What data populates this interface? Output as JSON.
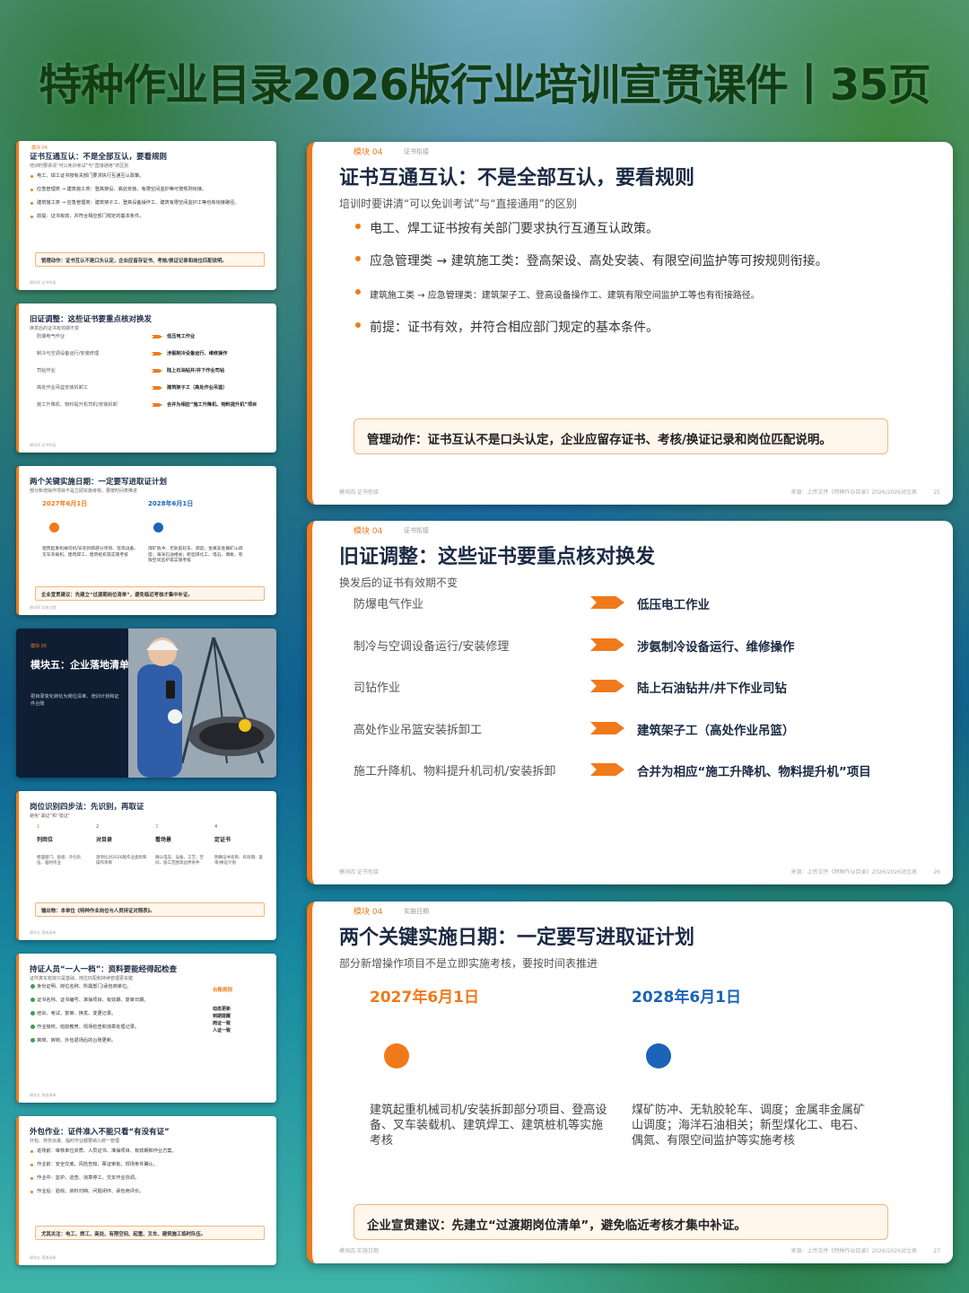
{
  "main_title": "特种作业目录2026版行业培训宣贯课件丨35页",
  "thumbs": {
    "t1": {
      "tag": "模块 04",
      "title": "证书互通互认：不是全部互认，要看规则",
      "sub": "培训时要讲清“可以免训考试”与“直接通用”的区别",
      "lines": [
        "电工、焊工证书按有关部门要求执行互通互认政策。",
        "应急管理类 → 建筑施工类：登高架设、高处安装、有限空间监护等可按规则衔接。",
        "建筑施工类 → 应急管理类：建筑架子工、登高设备操作工、建筑有限空间监护工等也有衔接路径。",
        "前提：证书有效，并符合相应部门规定的基本条件。"
      ],
      "box": "管理动作：证书互认不是口头认定，企业应留存证书、考核/换证记录和岗位匹配说明。",
      "foot": "模块四 证书衔接"
    },
    "t2": {
      "title": "旧证调整：这些证书要重点核对换发",
      "sub": "换发后的证书有效期不变",
      "left": [
        "防爆电气作业",
        "制冷与空调设备运行/安装修理",
        "司钻作业",
        "高处作业吊篮安装拆卸工",
        "施工升降机、物料提升机司机/安装拆卸"
      ],
      "right": [
        "低压电工作业",
        "涉氨制冷设备运行、维修操作",
        "陆上石油钻井/井下作业司钻",
        "建筑架子工（高处作业吊篮）",
        "合并为相应“施工升降机、物料提升机”项目"
      ],
      "foot": "模块四 证书衔接"
    },
    "t3": {
      "title": "两个关键实施日期：一定要写进取证计划",
      "sub": "部分新增操作项目不是立即实施考核，要按时间表推进",
      "d1": "2027年6月1日",
      "d2": "2028年6月1日",
      "desc1": "建筑起重机械司机/安装拆卸部分项目、登高设备、叉车装载机、建筑焊工、建筑桩机等实施考核",
      "desc2": "煤矿防冲、无轨胶轮车、调度；金属非金属矿山调度；海洋石油相关；新型煤化工、电石、偶氮、有限空间监护等实施考核",
      "box": "企业宣贯建议：先建立“过渡期岗位清单”，避免临近考核才集中补证。",
      "foot": "模块四 实施日期"
    },
    "t4": {
      "tag": "模块 05",
      "title": "模块五：企业落地清单",
      "sub": "把目录变化转化为岗位清单、培训计划和证件台账"
    },
    "t5": {
      "title": "岗位识别四步法：先识别，再取证",
      "sub": "避免“漏证”和“错证”",
      "steps": [
        {
          "n": "1",
          "h": "列岗位",
          "d": "梳理部门、班组、外包队伍、临时作业"
        },
        {
          "n": "2",
          "h": "对目录",
          "d": "逐项比对2026版作业类别和操作项目"
        },
        {
          "n": "3",
          "h": "看场景",
          "d": "确认电压、设备、工艺、空间、施工范围等边界条件"
        },
        {
          "n": "4",
          "h": "定证书",
          "d": "明确证书名称、有效期、复审/换证计划"
        }
      ],
      "box": "输出物：本单位《特种作业岗位与人员持证对照表》。",
      "foot": "模块五 落地清单"
    },
    "t6": {
      "title": "持证人员“一人一档”：资料要能经得起检查",
      "sub": "证件真实有效只是基础，岗位匹配和持续管理更关键",
      "lines": [
        "身份证明、岗位名称、所属部门/承包商单位。",
        "证书名称、证书编号、准操项目、有效期、复审日期。",
        "培训、考试、复审、换发、变更记录。",
        "作业授权、班前教育、现场检查和违章处理记录。",
        "离岗、转岗、外包退场后的台账更新。"
      ],
      "side_title": "台账原则",
      "side_lines": [
        "动态更新",
        "到期提醒",
        "岗证一致",
        "人证一致"
      ],
      "foot": "模块五 落地清单"
    },
    "t7": {
      "title": "外包作业：证件准入不能只看“有没有证”",
      "sub": "外包、劳务派遣、临时作业都要纳入统一管理",
      "lines": [
        "进场前：审核单位资质、人员证书、准操项目、有效期和作业方案。",
        "作业前：安全交底、风险告知、票证审批、现场条件确认。",
        "作业中：监护、巡查、违章停工、交叉作业协调。",
        "作业后：验收、资料归档、问题闭环、承包商评价。"
      ],
      "box": "尤其关注：电工、焊工、高处、有限空间、起重、叉车、建筑施工临时队伍。",
      "foot": "模块五 落地清单"
    }
  },
  "slide1": {
    "tag": "模块 04",
    "tag2": "证书衔接",
    "title": "证书互通互认：不是全部互认，要看规则",
    "sub": "培训时要讲清“可以免训考试”与“直接通用”的区别",
    "bullets": [
      "电工、焊工证书按有关部门要求执行互通互认政策。",
      "应急管理类 → 建筑施工类：登高架设、高处安装、有限空间监护等可按规则衔接。",
      "建筑施工类 → 应急管理类：建筑架子工、登高设备操作工、建筑有限空间监护工等也有衔接路径。",
      "前提：证书有效，并符合相应部门规定的基本条件。"
    ],
    "box": "管理动作：证书互认不是口头认定，企业应留存证书、考核/换证记录和岗位匹配说明。",
    "foot_l": "模块四 证书衔接",
    "foot_r": "来源：上传文件《特种作业目录》2026/2026对比表",
    "page": "25"
  },
  "slide2": {
    "tag": "模块 04",
    "tag2": "证书衔接",
    "title": "旧证调整：这些证书要重点核对换发",
    "sub": "换发后的证书有效期不变",
    "rows": [
      {
        "left": "防爆电气作业",
        "right": "低压电工作业"
      },
      {
        "left": "制冷与空调设备运行/安装修理",
        "right": "涉氨制冷设备运行、维修操作"
      },
      {
        "left": "司钻作业",
        "right": "陆上石油钻井/井下作业司钻"
      },
      {
        "left": "高处作业吊篮安装拆卸工",
        "right": "建筑架子工（高处作业吊篮）"
      },
      {
        "left": "施工升降机、物料提升机司机/安装拆卸",
        "right": "合并为相应“施工升降机、物料提升机”项目"
      }
    ],
    "foot_l": "模块四 证书衔接",
    "foot_r": "来源：上传文件《特种作业目录》2026/2026对比表",
    "page": "26"
  },
  "slide3": {
    "tag": "模块 04",
    "tag2": "实施日期",
    "title": "两个关键实施日期：一定要写进取证计划",
    "sub": "部分新增操作项目不是立即实施考核，要按时间表推进",
    "date1": "2027年6月1日",
    "date2": "2028年6月1日",
    "desc1": "建筑起重机械司机/安装拆卸部分项目、登高设备、叉车装载机、建筑焊工、建筑桩机等实施考核",
    "desc2": "煤矿防冲、无轨胶轮车、调度；金属非金属矿山调度；海洋石油相关；新型煤化工、电石、偶氮、有限空间监护等实施考核",
    "box": "企业宣贯建议：先建立“过渡期岗位清单”，避免临近考核才集中补证。",
    "foot_l": "模块四 实施日期",
    "foot_r": "来源：上传文件《特种作业目录》2026/2026对比表",
    "page": "27"
  },
  "colors": {
    "accent": "#f07a1a",
    "blue": "#1b64b8",
    "navy": "#1b2a44"
  }
}
